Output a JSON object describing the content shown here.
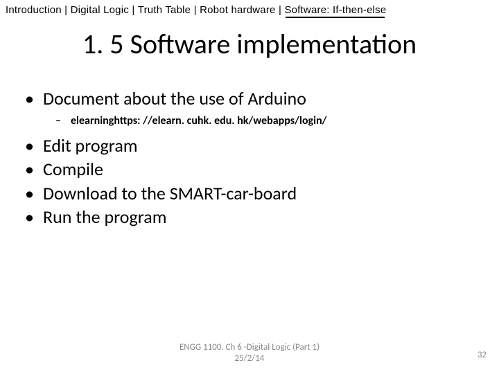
{
  "breadcrumb": {
    "items": [
      {
        "label": "Introduction",
        "active": false
      },
      {
        "label": "Digital Logic",
        "active": false
      },
      {
        "label": "Truth Table",
        "active": false
      },
      {
        "label": "Robot hardware",
        "active": false
      },
      {
        "label": "Software: If-then-else",
        "active": true
      }
    ],
    "separator": " | "
  },
  "title": "1. 5 Software implementation",
  "bullets": [
    {
      "text": "Document about the use of Arduino",
      "sub": "elearninghttps: //elearn. cuhk. edu. hk/webapps/login/"
    },
    {
      "text": "Edit program"
    },
    {
      "text": "Compile"
    },
    {
      "text": "Download to the SMART-car-board"
    },
    {
      "text": "Run the program"
    }
  ],
  "footer": {
    "line1": "ENGG 1100. Ch 6 -Digital Logic (Part 1)",
    "line2": "25/2/14",
    "page": "32"
  },
  "glyphs": {
    "bullet": "•",
    "dash": "–"
  }
}
